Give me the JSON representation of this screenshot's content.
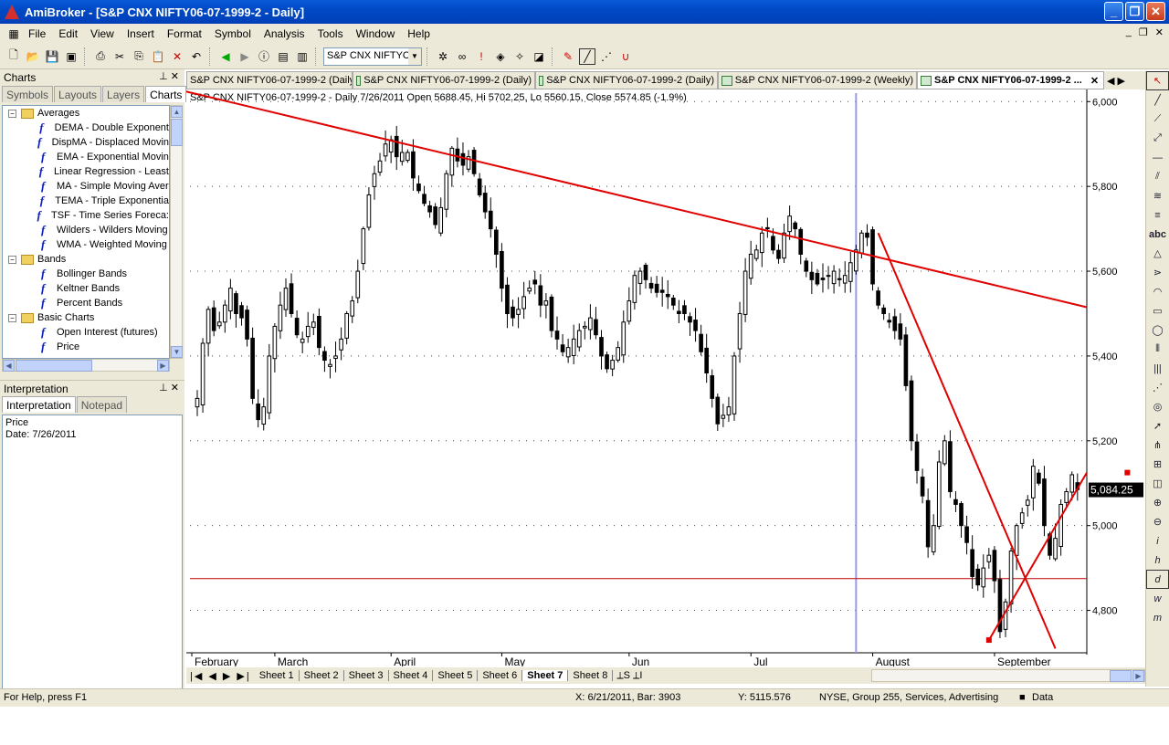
{
  "window": {
    "app": "AmiBroker",
    "title": "AmiBroker - [S&P CNX NIFTY06-07-1999-2 - Daily]"
  },
  "menu": [
    "File",
    "Edit",
    "View",
    "Insert",
    "Format",
    "Symbol",
    "Analysis",
    "Tools",
    "Window",
    "Help"
  ],
  "toolbar": {
    "symbol_combo": "S&P CNX NIFTYC"
  },
  "charts_panel": {
    "title": "Charts",
    "tabs": [
      "Symbols",
      "Layouts",
      "Layers",
      "Charts"
    ],
    "active_tab": "Charts",
    "tree": [
      {
        "type": "folder",
        "label": "Averages"
      },
      {
        "type": "fn",
        "label": "DEMA - Double Exponent"
      },
      {
        "type": "fn",
        "label": "DispMA - Displaced Movin"
      },
      {
        "type": "fn",
        "label": "EMA - Exponential Movin"
      },
      {
        "type": "fn",
        "label": "Linear Regression - Least"
      },
      {
        "type": "fn",
        "label": "MA - Simple Moving Aver"
      },
      {
        "type": "fn",
        "label": "TEMA - Triple Exponentia"
      },
      {
        "type": "fn",
        "label": "TSF - Time Series Foreca:"
      },
      {
        "type": "fn",
        "label": "Wilders - Wilders Moving"
      },
      {
        "type": "fn",
        "label": "WMA - Weighted Moving"
      },
      {
        "type": "folder",
        "label": "Bands"
      },
      {
        "type": "fn",
        "label": "Bollinger Bands"
      },
      {
        "type": "fn",
        "label": "Keltner Bands"
      },
      {
        "type": "fn",
        "label": "Percent Bands"
      },
      {
        "type": "folder",
        "label": "Basic Charts"
      },
      {
        "type": "fn",
        "label": "Open Interest (futures)"
      },
      {
        "type": "fn",
        "label": "Price"
      }
    ]
  },
  "interpretation_panel": {
    "title": "Interpretation",
    "tabs": [
      "Interpretation",
      "Notepad"
    ],
    "text_line1": "Price",
    "text_line2": "Date: 7/26/2011"
  },
  "chart_tabs": [
    "S&P CNX NIFTY06-07-1999-2 (Daily)",
    "S&P CNX NIFTY06-07-1999-2 (Daily)",
    "S&P CNX NIFTY06-07-1999-2 (Daily)",
    "S&P CNX NIFTY06-07-1999-2 (Weekly)",
    "S&P CNX NIFTY06-07-1999-2 ..."
  ],
  "sheets": [
    "Sheet 1",
    "Sheet 2",
    "Sheet 3",
    "Sheet 4",
    "Sheet 5",
    "Sheet 6",
    "Sheet 7",
    "Sheet 8"
  ],
  "active_sheet": "Sheet 7",
  "status": {
    "help": "For Help, press F1",
    "xpos": "X: 6/21/2011, Bar: 3903",
    "ypos": "Y: 5115.576",
    "info": "NYSE, Group 255, Services, Advertising",
    "data": "Data"
  },
  "chart_data": {
    "type": "candlestick",
    "header": "S&P CNX NIFTY06-07-1999-2 - Daily 7/26/2011 Open 5688.45, Hi 5702.25, Lo 5560.15, Close 5574.85 (-1.9%)",
    "last_price_label": "5,084.25",
    "ylim": [
      4700,
      6020
    ],
    "yticks": [
      4800,
      5000,
      5200,
      5400,
      5600,
      5800,
      6000
    ],
    "ytick_labels": [
      "4,800",
      "5,000",
      "5,200",
      "5,400",
      "5,600",
      "5,800",
      "6,000"
    ],
    "month_labels": [
      {
        "label": "February",
        "index": 0
      },
      {
        "label": "March",
        "index": 15
      },
      {
        "label": "April",
        "index": 36
      },
      {
        "label": "May",
        "index": 56
      },
      {
        "label": "Jun",
        "index": 79
      },
      {
        "label": "Jul",
        "index": 101
      },
      {
        "label": "August",
        "index": 123
      },
      {
        "label": "September",
        "index": 145
      }
    ],
    "closes": [
      5300,
      5430,
      5510,
      5460,
      5480,
      5520,
      5560,
      5500,
      5490,
      5440,
      5300,
      5250,
      5280,
      5400,
      5470,
      5520,
      5560,
      5500,
      5450,
      5440,
      5470,
      5480,
      5420,
      5390,
      5380,
      5400,
      5440,
      5500,
      5530,
      5600,
      5700,
      5780,
      5830,
      5860,
      5900,
      5910,
      5870,
      5880,
      5880,
      5820,
      5790,
      5760,
      5740,
      5710,
      5750,
      5830,
      5890,
      5860,
      5850,
      5870,
      5830,
      5780,
      5740,
      5700,
      5640,
      5560,
      5500,
      5490,
      5510,
      5540,
      5560,
      5570,
      5520,
      5530,
      5460,
      5440,
      5410,
      5420,
      5440,
      5460,
      5470,
      5490,
      5450,
      5400,
      5370,
      5390,
      5420,
      5480,
      5530,
      5590,
      5600,
      5580,
      5560,
      5550,
      5550,
      5540,
      5520,
      5500,
      5500,
      5480,
      5460,
      5410,
      5360,
      5300,
      5240,
      5260,
      5280,
      5400,
      5500,
      5600,
      5640,
      5650,
      5690,
      5700,
      5650,
      5630,
      5690,
      5730,
      5700,
      5640,
      5600,
      5580,
      5570,
      5580,
      5590,
      5600,
      5580,
      5590,
      5620,
      5650,
      5690,
      5680,
      5570,
      5520,
      5500,
      5480,
      5460,
      5440,
      5330,
      5200,
      5130,
      5070,
      4950,
      5000,
      5150,
      5200,
      5080,
      5050,
      5000,
      4960,
      4880,
      4860,
      4900,
      4930,
      4870,
      4750,
      4820,
      4940,
      5000,
      5030,
      5060,
      5140,
      5100,
      5000,
      4930,
      4970,
      5050,
      5080,
      5120,
      5085
    ],
    "trendlines": [
      {
        "from": [
          -4,
          6030
        ],
        "to": [
          175,
          5515
        ],
        "color": "#e00000"
      },
      {
        "from": [
          123,
          5690
        ],
        "to": [
          155,
          4710
        ],
        "color": "#e00000"
      },
      {
        "from": [
          143,
          4730
        ],
        "to": [
          168,
          5125
        ],
        "color": "#e00000"
      }
    ],
    "horizontal_line": 4875,
    "vertical_marker_index": 119
  }
}
